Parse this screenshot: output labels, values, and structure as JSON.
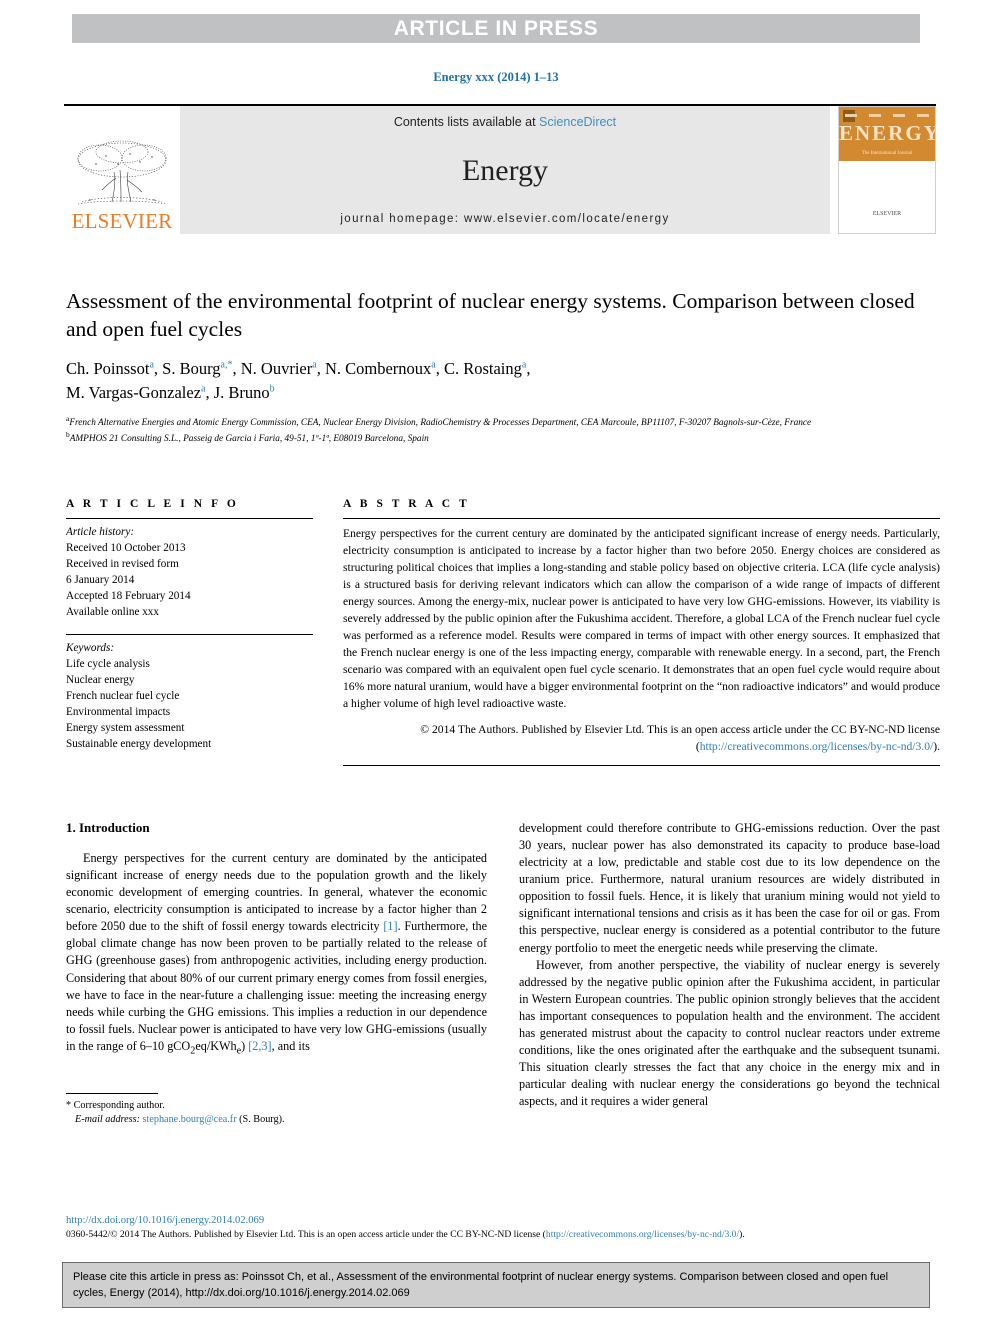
{
  "banner": {
    "text": "ARTICLE IN PRESS"
  },
  "running_head": "Energy xxx (2014) 1–13",
  "masthead": {
    "publisher_wordmark": "ELSEVIER",
    "contents_prefix": "Contents lists available at ",
    "contents_link": "ScienceDirect",
    "journal_name": "Energy",
    "homepage": "journal homepage: www.elsevier.com/locate/energy",
    "cover": {
      "title": "ENERGY",
      "subtitle": "The International Journal",
      "logo": "ELSEVIER"
    }
  },
  "article": {
    "title": "Assessment of the environmental footprint of nuclear energy systems. Comparison between closed and open fuel cycles",
    "authors": [
      {
        "name": "Ch. Poinssot",
        "marks": "a"
      },
      {
        "name": "S. Bourg",
        "marks": "a,*"
      },
      {
        "name": "N. Ouvrier",
        "marks": "a"
      },
      {
        "name": "N. Combernoux",
        "marks": "a"
      },
      {
        "name": "C. Rostaing",
        "marks": "a"
      },
      {
        "name": "M. Vargas-Gonzalez",
        "marks": "a"
      },
      {
        "name": "J. Bruno",
        "marks": "b"
      }
    ],
    "affiliations": [
      {
        "mark": "a",
        "text": "French Alternative Energies and Atomic Energy Commission, CEA, Nuclear Energy Division, RadioChemistry & Processes Department, CEA Marcoule, BP11107, F-30207 Bagnols-sur-Cèze, France"
      },
      {
        "mark": "b",
        "text": "AMPHOS 21 Consulting S.L., Passeig de Garcia i Faria, 49-51, 1º-1ª, E08019 Barcelona, Spain"
      }
    ]
  },
  "article_info": {
    "heading": "A R T I C L E  I N F O",
    "history_label": "Article history:",
    "history": [
      "Received 10 October 2013",
      "Received in revised form",
      "6 January 2014",
      "Accepted 18 February 2014",
      "Available online xxx"
    ],
    "keywords_label": "Keywords:",
    "keywords": [
      "Life cycle analysis",
      "Nuclear energy",
      "French nuclear fuel cycle",
      "Environmental impacts",
      "Energy system assessment",
      "Sustainable energy development"
    ]
  },
  "abstract": {
    "heading": "A B S T R A C T",
    "text": "Energy perspectives for the current century are dominated by the anticipated significant increase of energy needs. Particularly, electricity consumption is anticipated to increase by a factor higher than two before 2050. Energy choices are considered as structuring political choices that implies a long-standing and stable policy based on objective criteria. LCA (life cycle analysis) is a structured basis for deriving relevant indicators which can allow the comparison of a wide range of impacts of different energy sources. Among the energy-mix, nuclear power is anticipated to have very low GHG-emissions. However, its viability is severely addressed by the public opinion after the Fukushima accident. Therefore, a global LCA of the French nuclear fuel cycle was performed as a reference model. Results were compared in terms of impact with other energy sources. It emphasized that the French nuclear energy is one of the less impacting energy, comparable with renewable energy. In a second, part, the French scenario was compared with an equivalent open fuel cycle scenario. It demonstrates that an open fuel cycle would require about 16% more natural uranium, would have a bigger environmental footprint on the “non radioactive indicators” and would produce a higher volume of high level radioactive waste.",
    "copyright_prefix": "© 2014 The Authors. Published by Elsevier Ltd. This is an open access article under the CC BY-NC-ND license (",
    "copyright_link": "http://creativecommons.org/licenses/by-nc-nd/3.0/",
    "copyright_suffix": ")."
  },
  "body": {
    "section_heading": "1. Introduction",
    "left_paragraph_1": "Energy perspectives for the current century are dominated by the anticipated significant increase of energy needs due to the population growth and the likely economic development of emerging countries. In general, whatever the economic scenario, electricity consumption is anticipated to increase by a factor higher than 2 before 2050 due to the shift of fossil energy towards electricity ",
    "ref_1": "[1]",
    "left_paragraph_1b": ". Furthermore, the global climate change has now been proven to be partially related to the release of GHG (greenhouse gases) from anthropogenic activities, including energy production. Considering that about 80% of our current primary energy comes from fossil energies, we have to face in the near-future a challenging issue: meeting the increasing energy needs while curbing the GHG emissions. This implies a reduction in our dependence to fossil fuels. Nuclear power is anticipated to have very low GHG-emissions (usually in the range of 6–10 gCO",
    "left_paragraph_1c": "eq/KWh",
    "ref_23": "[2,3]",
    "left_paragraph_1d": ", and its",
    "right_paragraph_1": "development could therefore contribute to GHG-emissions reduction. Over the past 30 years, nuclear power has also demonstrated its capacity to produce base-load electricity at a low, predictable and stable cost due to its low dependence on the uranium price. Furthermore, natural uranium resources are widely distributed in opposition to fossil fuels. Hence, it is likely that uranium mining would not yield to significant international tensions and crisis as it has been the case for oil or gas. From this perspective, nuclear energy is considered as a potential contributor to the future energy portfolio to meet the energetic needs while preserving the climate.",
    "right_paragraph_2": "However, from another perspective, the viability of nuclear energy is severely addressed by the negative public opinion after the Fukushima accident, in particular in Western European countries. The public opinion strongly believes that the accident has important consequences to population health and the environment. The accident has generated mistrust about the capacity to control nuclear reactors under extreme conditions, like the ones originated after the earthquake and the subsequent tsunami. This situation clearly stresses the fact that any choice in the energy mix and in particular dealing with nuclear energy the considerations go beyond the technical aspects, and it requires a wider general"
  },
  "footnote": {
    "corresponding": "* Corresponding author.",
    "email_label": "E-mail address:",
    "email": "stephane.bourg@cea.fr",
    "email_owner": "(S. Bourg)."
  },
  "footer": {
    "doi": "http://dx.doi.org/10.1016/j.energy.2014.02.069",
    "issn_prefix": "0360-5442/© 2014 The Authors. Published by Elsevier Ltd. This is an open access article under the CC BY-NC-ND license (",
    "issn_link": "http://creativecommons.org/licenses/by-nc-nd/3.0/",
    "issn_suffix": ")."
  },
  "citation_box": {
    "text": "Please cite this article in press as: Poinssot Ch, et al., Assessment of the environmental footprint of nuclear energy systems. Comparison between closed and open fuel cycles, Energy (2014), http://dx.doi.org/10.1016/j.energy.2014.02.069"
  },
  "colors": {
    "banner_gray": "#bfc1c3",
    "link_blue": "#2e7fb8",
    "sciencedirect_blue": "#3e8fc4",
    "elsevier_orange": "#ee7b22",
    "band_gray": "#e7e7e7",
    "cite_box_gray": "#cfcfcf",
    "cover_orange": "#d2892f"
  }
}
